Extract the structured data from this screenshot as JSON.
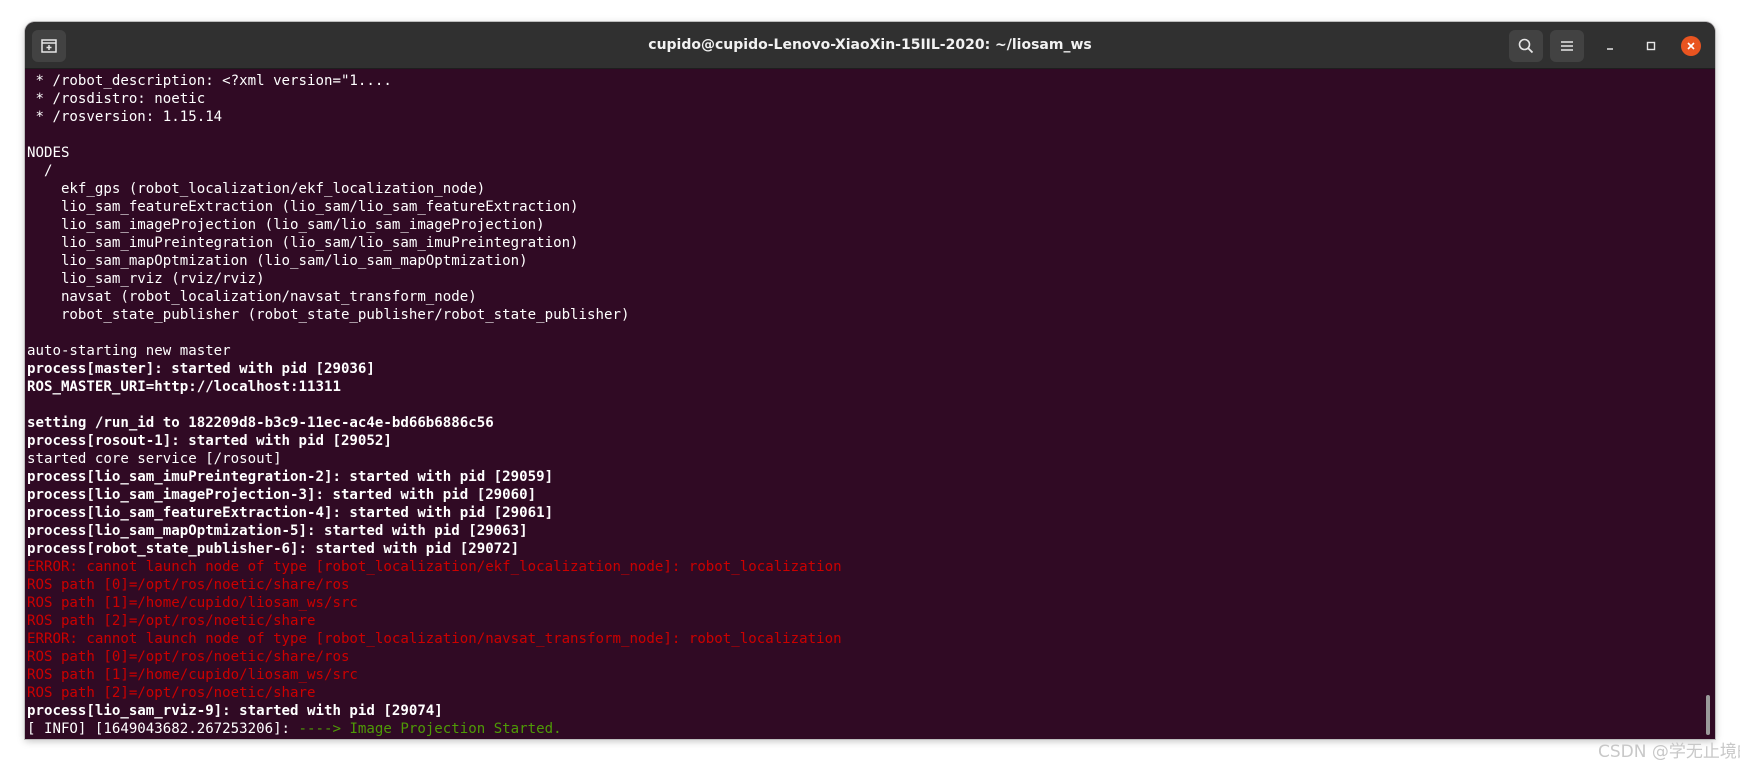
{
  "window": {
    "title": "cupido@cupido-Lenovo-XiaoXin-15IIL-2020: ~/liosam_ws"
  },
  "terminal": {
    "lines": [
      {
        "text": " * /robot_description: <?xml version=\"1....",
        "style": "normal"
      },
      {
        "text": " * /rosdistro: noetic",
        "style": "normal"
      },
      {
        "text": " * /rosversion: 1.15.14",
        "style": "normal"
      },
      {
        "text": "",
        "style": "normal"
      },
      {
        "text": "NODES",
        "style": "normal"
      },
      {
        "text": "  /",
        "style": "normal"
      },
      {
        "text": "    ekf_gps (robot_localization/ekf_localization_node)",
        "style": "normal"
      },
      {
        "text": "    lio_sam_featureExtraction (lio_sam/lio_sam_featureExtraction)",
        "style": "normal"
      },
      {
        "text": "    lio_sam_imageProjection (lio_sam/lio_sam_imageProjection)",
        "style": "normal"
      },
      {
        "text": "    lio_sam_imuPreintegration (lio_sam/lio_sam_imuPreintegration)",
        "style": "normal"
      },
      {
        "text": "    lio_sam_mapOptmization (lio_sam/lio_sam_mapOptmization)",
        "style": "normal"
      },
      {
        "text": "    lio_sam_rviz (rviz/rviz)",
        "style": "normal"
      },
      {
        "text": "    navsat (robot_localization/navsat_transform_node)",
        "style": "normal"
      },
      {
        "text": "    robot_state_publisher (robot_state_publisher/robot_state_publisher)",
        "style": "normal"
      },
      {
        "text": "",
        "style": "normal"
      },
      {
        "text": "auto-starting new master",
        "style": "normal"
      },
      {
        "text": "process[master]: started with pid [29036]",
        "style": "bold"
      },
      {
        "text": "ROS_MASTER_URI=http://localhost:11311",
        "style": "bold"
      },
      {
        "text": "",
        "style": "normal"
      },
      {
        "text": "setting /run_id to 182209d8-b3c9-11ec-ac4e-bd66b6886c56",
        "style": "bold"
      },
      {
        "text": "process[rosout-1]: started with pid [29052]",
        "style": "bold"
      },
      {
        "text": "started core service [/rosout]",
        "style": "normal"
      },
      {
        "text": "process[lio_sam_imuPreintegration-2]: started with pid [29059]",
        "style": "bold"
      },
      {
        "text": "process[lio_sam_imageProjection-3]: started with pid [29060]",
        "style": "bold"
      },
      {
        "text": "process[lio_sam_featureExtraction-4]: started with pid [29061]",
        "style": "bold"
      },
      {
        "text": "process[lio_sam_mapOptmization-5]: started with pid [29063]",
        "style": "bold"
      },
      {
        "text": "process[robot_state_publisher-6]: started with pid [29072]",
        "style": "bold"
      },
      {
        "text": "ERROR: cannot launch node of type [robot_localization/ekf_localization_node]: robot_localization",
        "style": "error"
      },
      {
        "text": "ROS path [0]=/opt/ros/noetic/share/ros",
        "style": "error"
      },
      {
        "text": "ROS path [1]=/home/cupido/liosam_ws/src",
        "style": "error"
      },
      {
        "text": "ROS path [2]=/opt/ros/noetic/share",
        "style": "error"
      },
      {
        "text": "ERROR: cannot launch node of type [robot_localization/navsat_transform_node]: robot_localization",
        "style": "error"
      },
      {
        "text": "ROS path [0]=/opt/ros/noetic/share/ros",
        "style": "error"
      },
      {
        "text": "ROS path [1]=/home/cupido/liosam_ws/src",
        "style": "error"
      },
      {
        "text": "ROS path [2]=/opt/ros/noetic/share",
        "style": "error"
      },
      {
        "text": "process[lio_sam_rviz-9]: started with pid [29074]",
        "style": "bold"
      }
    ],
    "info_line": {
      "prefix": "[ INFO] [1649043682.267253206]: ",
      "message": "----> Image Projection Started."
    }
  },
  "watermark": "CSDN @学无止境的小龟",
  "colors": {
    "background": "#300a24",
    "titlebar": "#303030",
    "error": "#cc0000",
    "info": "#4e9a06",
    "close": "#e95420"
  }
}
